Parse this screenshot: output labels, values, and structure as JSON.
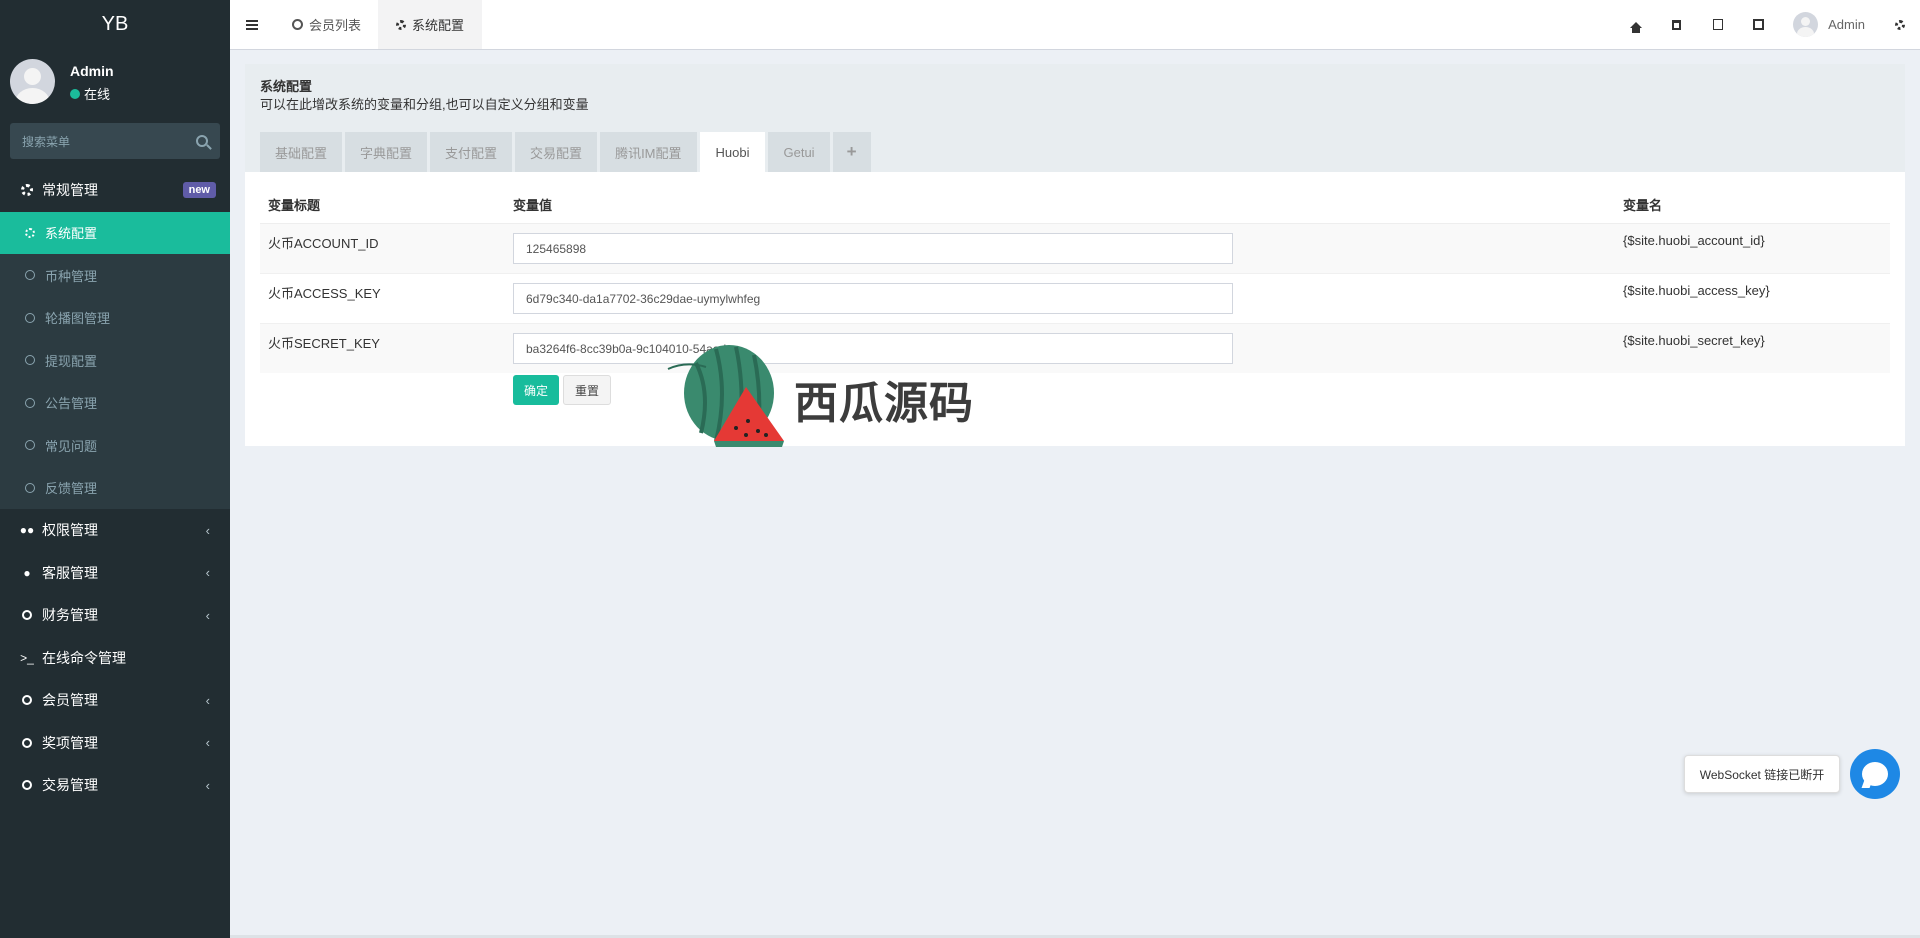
{
  "app": {
    "logo": "YB"
  },
  "user": {
    "name": "Admin",
    "status": "在线"
  },
  "search": {
    "placeholder": "搜索菜单"
  },
  "sidebar": {
    "group_general": {
      "label": "常规管理",
      "badge": "new"
    },
    "sub_items": [
      {
        "label": "系统配置",
        "active": true
      },
      {
        "label": "币种管理"
      },
      {
        "label": "轮播图管理"
      },
      {
        "label": "提现配置"
      },
      {
        "label": "公告管理"
      },
      {
        "label": "常见问题"
      },
      {
        "label": "反馈管理"
      }
    ],
    "items": [
      {
        "label": "权限管理",
        "icon": "users-icon"
      },
      {
        "label": "客服管理",
        "icon": "comment-icon"
      },
      {
        "label": "财务管理",
        "icon": "circle-icon"
      },
      {
        "label": "在线命令管理",
        "icon": "terminal-icon"
      },
      {
        "label": "会员管理",
        "icon": "circle-icon"
      },
      {
        "label": "奖项管理",
        "icon": "circle-icon"
      },
      {
        "label": "交易管理",
        "icon": "circle-icon"
      }
    ]
  },
  "topbar": {
    "tabs": [
      {
        "label": "会员列表"
      },
      {
        "label": "系统配置"
      }
    ],
    "user_name": "Admin"
  },
  "panel": {
    "title": "系统配置",
    "description": "可以在此增改系统的变量和分组,也可以自定义分组和变量",
    "tabs": [
      "基础配置",
      "字典配置",
      "支付配置",
      "交易配置",
      "腾讯IM配置",
      "Huobi",
      "Getui",
      "+"
    ],
    "active_tab": "Huobi",
    "table": {
      "headers": [
        "变量标题",
        "变量值",
        "变量名"
      ],
      "rows": [
        {
          "title": "火币ACCOUNT_ID",
          "value": "125465898",
          "name": "{$site.huobi_account_id}"
        },
        {
          "title": "火币ACCESS_KEY",
          "value": "6d79c340-da1a7702-36c29dae-uymylwhfeg",
          "name": "{$site.huobi_access_key}"
        },
        {
          "title": "火币SECRET_KEY",
          "value": "ba3264f6-8cc39b0a-9c104010-54aad",
          "name": "{$site.huobi_secret_key}"
        }
      ]
    },
    "buttons": {
      "confirm": "确定",
      "reset": "重置"
    }
  },
  "watermark": {
    "text": "西瓜源码"
  },
  "websocket": {
    "tip": "WebSocket 链接已断开"
  },
  "colors": {
    "sidebar_bg": "#222d32",
    "accent": "#18bc9c",
    "badge": "#605ca8",
    "ws_button": "#1e88e5"
  }
}
